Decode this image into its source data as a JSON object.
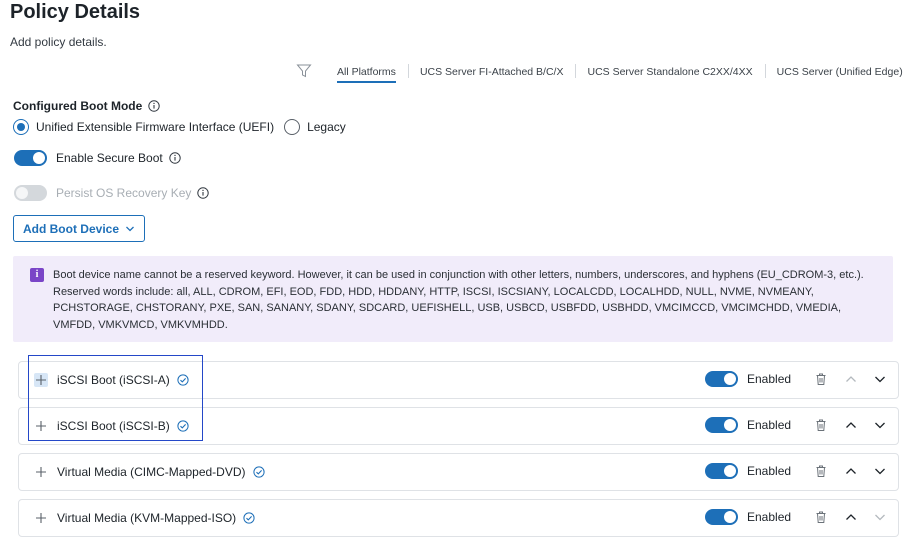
{
  "header": {
    "title": "Policy Details",
    "subtitle": "Add policy details."
  },
  "platform_tabs": [
    {
      "label": "All Platforms",
      "active": true
    },
    {
      "label": "UCS Server FI-Attached B/C/X",
      "active": false
    },
    {
      "label": "UCS Server Standalone C2XX/4XX",
      "active": false
    },
    {
      "label": "UCS Server (Unified Edge)",
      "active": false
    }
  ],
  "boot_mode": {
    "label": "Configured Boot Mode",
    "options": [
      {
        "label": "Unified Extensible Firmware Interface (UEFI)",
        "selected": true
      },
      {
        "label": "Legacy",
        "selected": false
      }
    ]
  },
  "secure_boot": {
    "label": "Enable Secure Boot",
    "enabled": true
  },
  "persist_key": {
    "label": "Persist OS Recovery Key",
    "enabled": false,
    "disabled": true
  },
  "add_boot_device": {
    "label": "Add Boot Device"
  },
  "notice": {
    "icon_letter": "i",
    "text": "Boot device name cannot be a reserved keyword. However, it can be used in conjunction with other letters, numbers, underscores, and hyphens (EU_CDROM-3, etc.). Reserved words include: all, ALL, CDROM, EFI, EOD, FDD, HDD, HDDANY, HTTP, ISCSI, ISCSIANY, LOCALCDD, LOCALHDD, NULL, NVME, NVMEANY, PCHSTORAGE, CHSTORANY, PXE, SAN, SANANY, SDANY, SDCARD, UEFISHELL, USB, USBCD, USBFDD, USBHDD, VMCIMCCD, VMCIMCHDD, VMEDIA, VMFDD, VMKVMCD, VMKVMHDD."
  },
  "boot_devices": [
    {
      "label": "iSCSI Boot (iSCSI-A)",
      "status": "Enabled",
      "enabled": true
    },
    {
      "label": "iSCSI Boot (iSCSI-B)",
      "status": "Enabled",
      "enabled": true
    },
    {
      "label": "Virtual Media (CIMC-Mapped-DVD)",
      "status": "Enabled",
      "enabled": true
    },
    {
      "label": "Virtual Media (KVM-Mapped-ISO)",
      "status": "Enabled",
      "enabled": true
    }
  ],
  "colors": {
    "accent": "#1d6fb8",
    "notice_bg": "#f1ecfa",
    "notice_icon": "#7a45c7",
    "highlight_box": "#2448c8"
  }
}
